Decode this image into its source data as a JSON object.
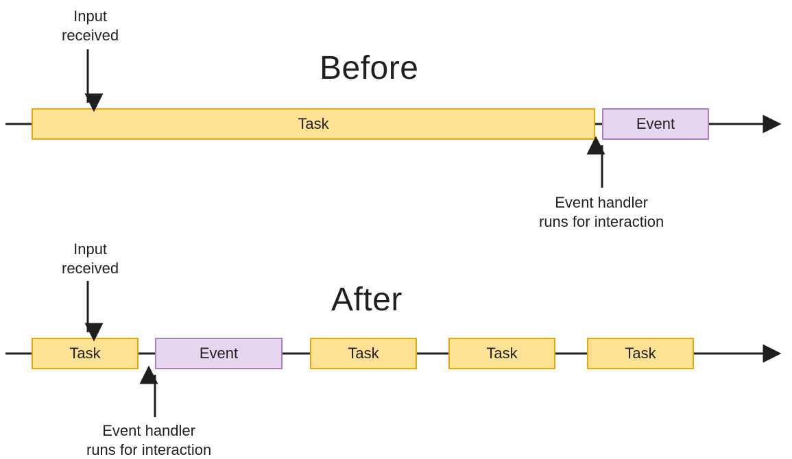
{
  "before": {
    "title": "Before",
    "input_label": "Input\nreceived",
    "handler_label": "Event handler\nruns for interaction",
    "boxes": {
      "task": "Task",
      "event": "Event"
    }
  },
  "after": {
    "title": "After",
    "input_label": "Input\nreceived",
    "handler_label": "Event handler\nruns for interaction",
    "boxes": {
      "task1": "Task",
      "event": "Event",
      "task2": "Task",
      "task3": "Task",
      "task4": "Task"
    }
  },
  "colors": {
    "task_fill": "#fde293",
    "task_stroke": "#e8a90c",
    "event_fill": "#e6d6ef",
    "event_stroke": "#a97fbf",
    "line": "#1f1f1f"
  }
}
